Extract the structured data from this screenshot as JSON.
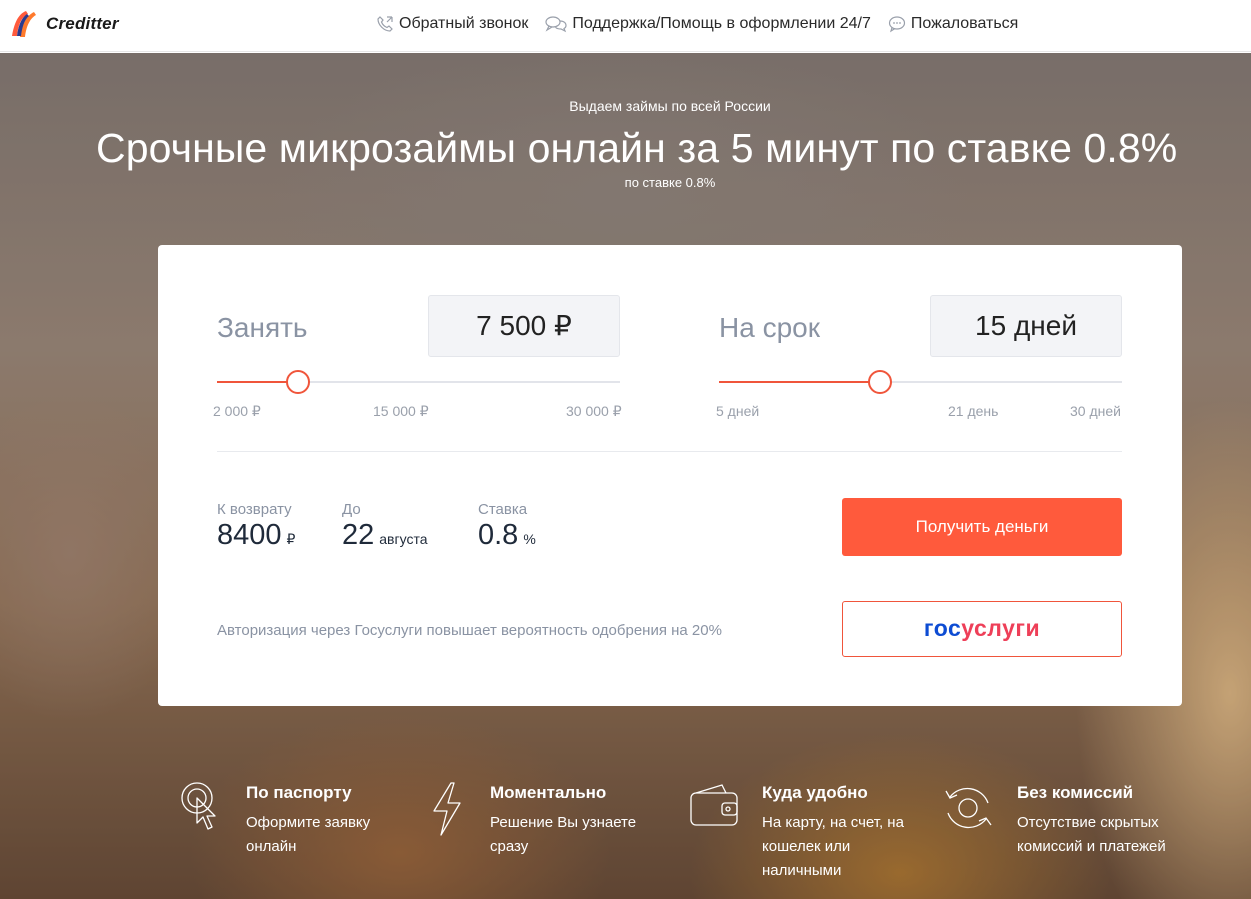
{
  "header": {
    "brand": "Creditter",
    "nav": [
      {
        "label": "Обратный звонок",
        "icon": "phone-icon"
      },
      {
        "label": "Поддержка/Помощь в оформлении 24/7",
        "icon": "chat-bubbles-icon"
      },
      {
        "label": "Пожаловаться",
        "icon": "speech-bubble-icon"
      }
    ]
  },
  "hero": {
    "sup": "Выдаем займы по всей России",
    "title": "Срочные микрозаймы онлайн за 5 минут по ставке 0.8%",
    "sub": "по ставке 0.8%"
  },
  "calculator": {
    "amount": {
      "label": "Занять",
      "value": "7 500 ₽",
      "slider_fraction": 0.2,
      "ticks": [
        "2 000 ₽",
        "15 000 ₽",
        "30 000 ₽"
      ]
    },
    "term": {
      "label": "На срок",
      "value": "15 дней",
      "slider_fraction": 0.4,
      "ticks": [
        "5 дней",
        "21 день",
        "30 дней"
      ]
    },
    "summary": {
      "return_label": "К возврату",
      "return_value": "8400",
      "return_unit": "₽",
      "until_label": "До",
      "until_value": "22",
      "until_unit": "августа",
      "rate_label": "Ставка",
      "rate_value": "0.8",
      "rate_unit": "%"
    },
    "get_money_button": "Получить деньги",
    "gosuslugi_note": "Авторизация через Госуслуги повышает вероятность одобрения на 20%",
    "gosuslugi_part1": "гос",
    "gosuslugi_part2": "услуги"
  },
  "features": [
    {
      "title": "По паспорту",
      "text": "Оформите заявку онлайн",
      "icon": "touch-pointer-icon"
    },
    {
      "title": "Моментально",
      "text": "Решение Вы узнаете сразу",
      "icon": "lightning-icon"
    },
    {
      "title": "Куда удобно",
      "text": "На карту, на счет, на кошелек или наличными",
      "icon": "wallet-icon"
    },
    {
      "title": "Без комиссий",
      "text": "Отсутствие скрытых комиссий и платежей",
      "icon": "refresh-circle-icon"
    }
  ],
  "colors": {
    "accent": "#ff5a3c",
    "gos_blue": "#0d4cd3",
    "gos_red": "#ee3f58"
  }
}
